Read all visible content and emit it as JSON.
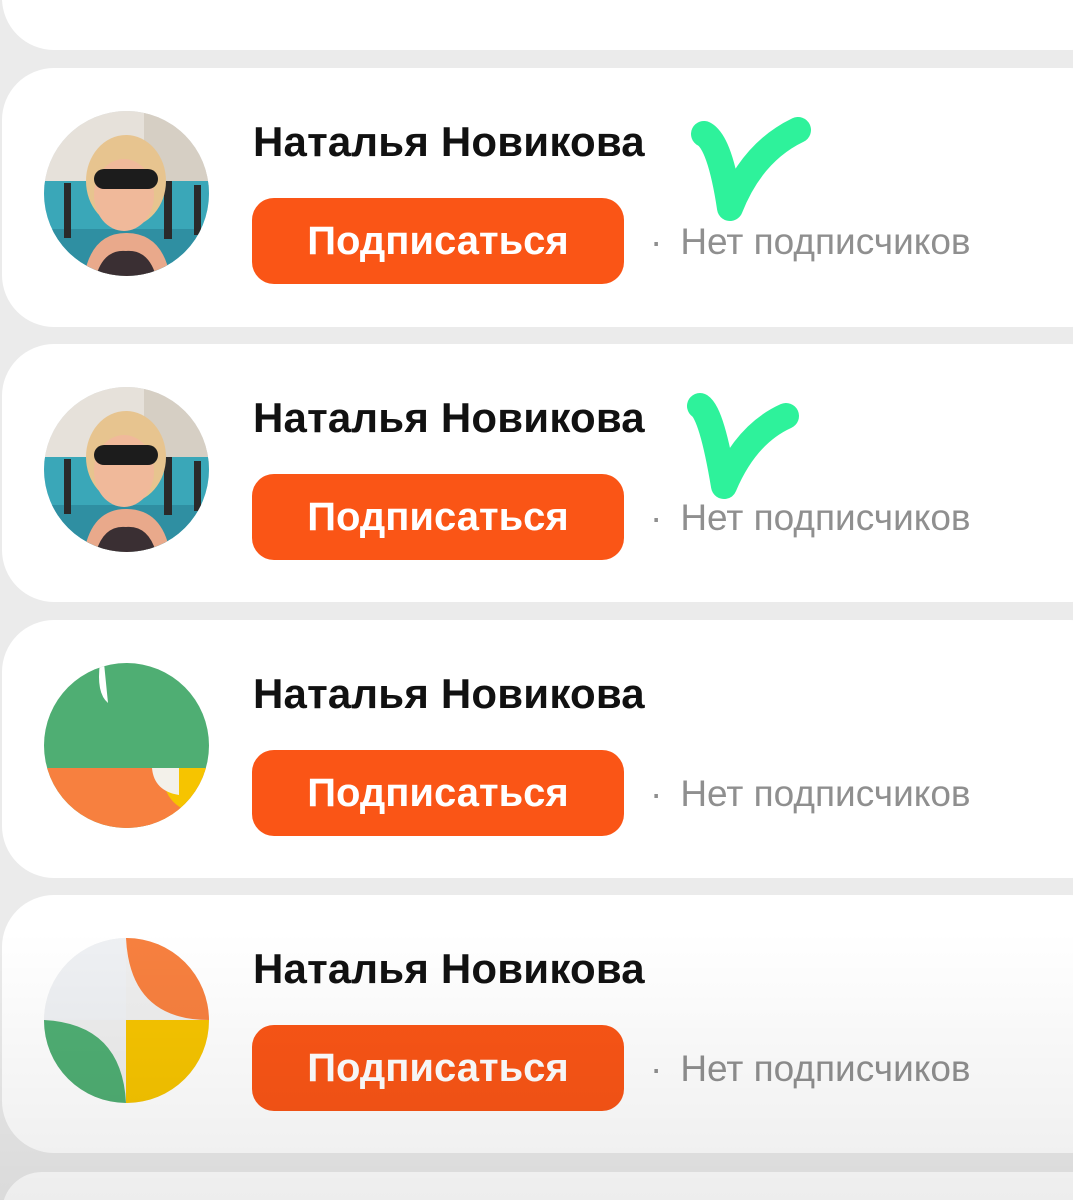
{
  "accent_color": "#fa5516",
  "check_color": "#2ef29b",
  "users": [
    {
      "name": "Наталья Новикова",
      "button_label": "Подписаться",
      "separator": "·",
      "followers_text": "Нет подписчиков",
      "avatar": "photo",
      "checked": true
    },
    {
      "name": "Наталья Новикова",
      "button_label": "Подписаться",
      "separator": "·",
      "followers_text": "Нет подписчиков",
      "avatar": "photo",
      "checked": true
    },
    {
      "name": "Наталья Новикова",
      "button_label": "Подписаться",
      "separator": "·",
      "followers_text": "Нет подписчиков",
      "avatar": "abstract-green-orange",
      "checked": false
    },
    {
      "name": "Наталья Новикова",
      "button_label": "Подписаться",
      "separator": "·",
      "followers_text": "Нет подписчиков",
      "avatar": "abstract-four-petals",
      "checked": false
    }
  ]
}
